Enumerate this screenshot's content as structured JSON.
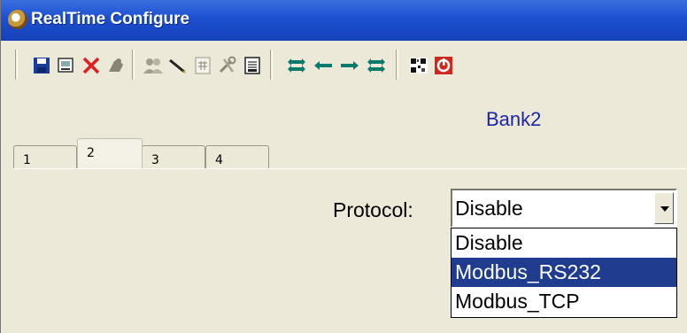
{
  "window": {
    "title": "RealTime Configure",
    "icon": "app-gear-icon"
  },
  "toolbar": {
    "buttons": [
      {
        "name": "save-icon"
      },
      {
        "name": "print-preview-icon"
      },
      {
        "name": "delete-icon"
      },
      {
        "name": "clear-icon"
      },
      {
        "name": "users-icon"
      },
      {
        "name": "pencil-icon"
      },
      {
        "name": "calculator-icon"
      },
      {
        "name": "tools-icon"
      },
      {
        "name": "report-icon"
      },
      {
        "name": "first-icon"
      },
      {
        "name": "previous-icon"
      },
      {
        "name": "next-icon"
      },
      {
        "name": "last-icon"
      },
      {
        "name": "qr-icon"
      },
      {
        "name": "power-icon"
      }
    ]
  },
  "main": {
    "bank_title": "Bank2",
    "tabs": [
      {
        "label": "1",
        "active": false
      },
      {
        "label": "2",
        "active": true
      },
      {
        "label": "3",
        "active": false
      },
      {
        "label": "4",
        "active": false
      }
    ],
    "protocol": {
      "label": "Protocol:",
      "selected": "Disable",
      "options": [
        "Disable",
        "Modbus_RS232",
        "Modbus_TCP"
      ],
      "highlighted": "Modbus_RS232"
    }
  },
  "colors": {
    "titlebar": "#1c4fd0",
    "bank_title": "#1a26a6",
    "highlight": "#1f3c8f"
  }
}
